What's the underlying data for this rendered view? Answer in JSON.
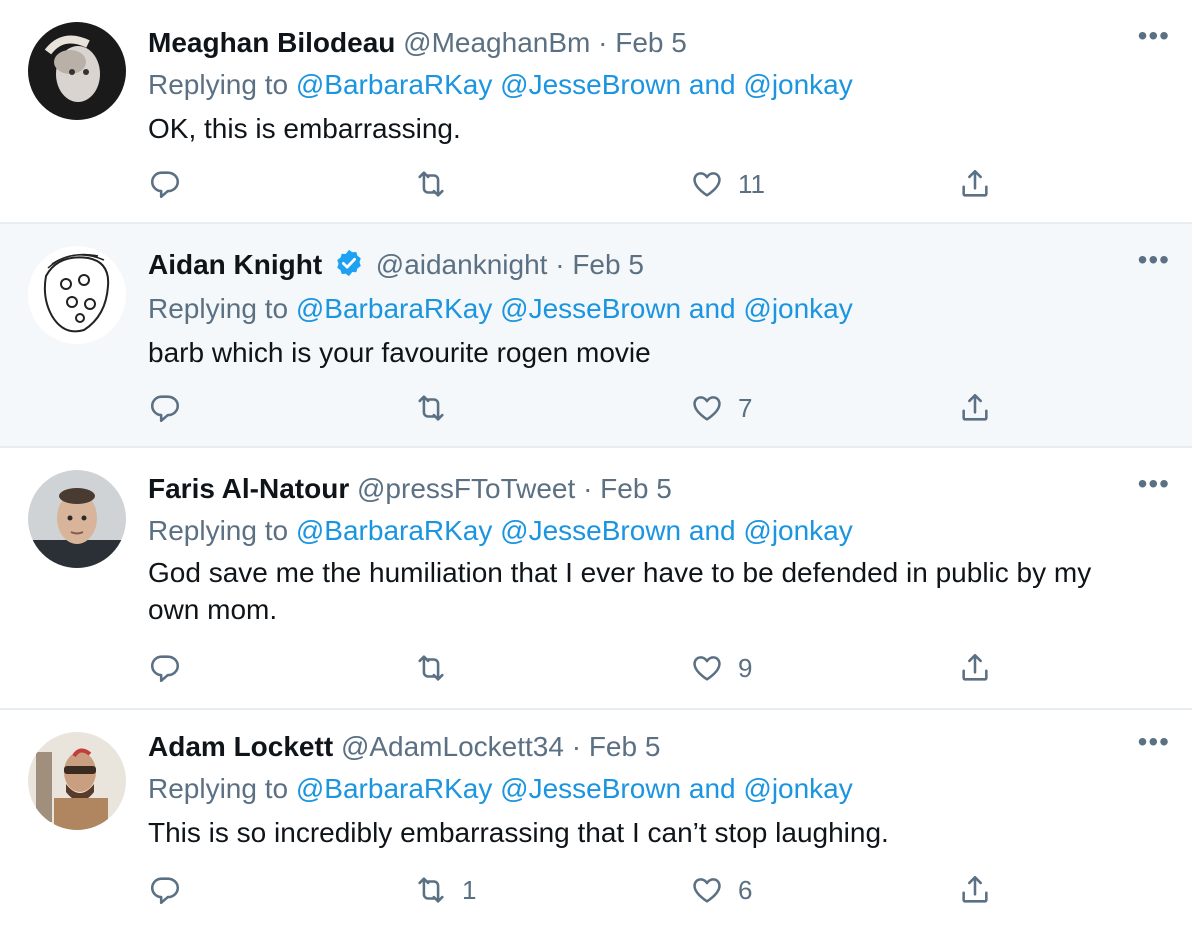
{
  "tweets": [
    {
      "name": "Meaghan Bilodeau",
      "handle": "@MeaghanBm",
      "sep": "·",
      "date": "Feb 5",
      "verified": false,
      "replying_prefix": "Replying to",
      "mention1": "@BarbaraRKay",
      "mention2": "@JesseBrown",
      "and": "and",
      "mention3": "@jonkay",
      "text": "OK, this is embarrassing.",
      "retweets": "",
      "likes": "11",
      "more": "•••"
    },
    {
      "name": "Aidan Knight",
      "handle": "@aidanknight",
      "sep": "·",
      "date": "Feb 5",
      "verified": true,
      "replying_prefix": "Replying to",
      "mention1": "@BarbaraRKay",
      "mention2": "@JesseBrown",
      "and": "and",
      "mention3": "@jonkay",
      "text": "barb which is your favourite rogen movie",
      "retweets": "",
      "likes": "7",
      "more": "•••"
    },
    {
      "name": "Faris Al-Natour",
      "handle": "@pressFToTweet",
      "sep": "·",
      "date": "Feb 5",
      "verified": false,
      "replying_prefix": "Replying to",
      "mention1": "@BarbaraRKay",
      "mention2": "@JesseBrown",
      "and": "and",
      "mention3": "@jonkay",
      "text": "God save me the humiliation that I ever have to be defended in public by my own mom.",
      "retweets": "",
      "likes": "9",
      "more": "•••"
    },
    {
      "name": "Adam Lockett",
      "handle": "@AdamLockett34",
      "sep": "·",
      "date": "Feb 5",
      "verified": false,
      "replying_prefix": "Replying to",
      "mention1": "@BarbaraRKay",
      "mention2": "@JesseBrown",
      "and": "and",
      "mention3": "@jonkay",
      "text": "This is so incredibly embarrassing that I can’t stop laughing.",
      "retweets": "1",
      "likes": "6",
      "more": "•••"
    }
  ],
  "colors": {
    "link": "#1b95e0",
    "muted": "#5b7083",
    "highlight_bg": "#f5f8fa",
    "verified": "#1da1f2"
  },
  "icons": {
    "reply": "reply-icon",
    "retweet": "retweet-icon",
    "like": "heart-icon",
    "share": "share-icon",
    "verified": "verified-badge-icon",
    "more": "more-icon"
  }
}
